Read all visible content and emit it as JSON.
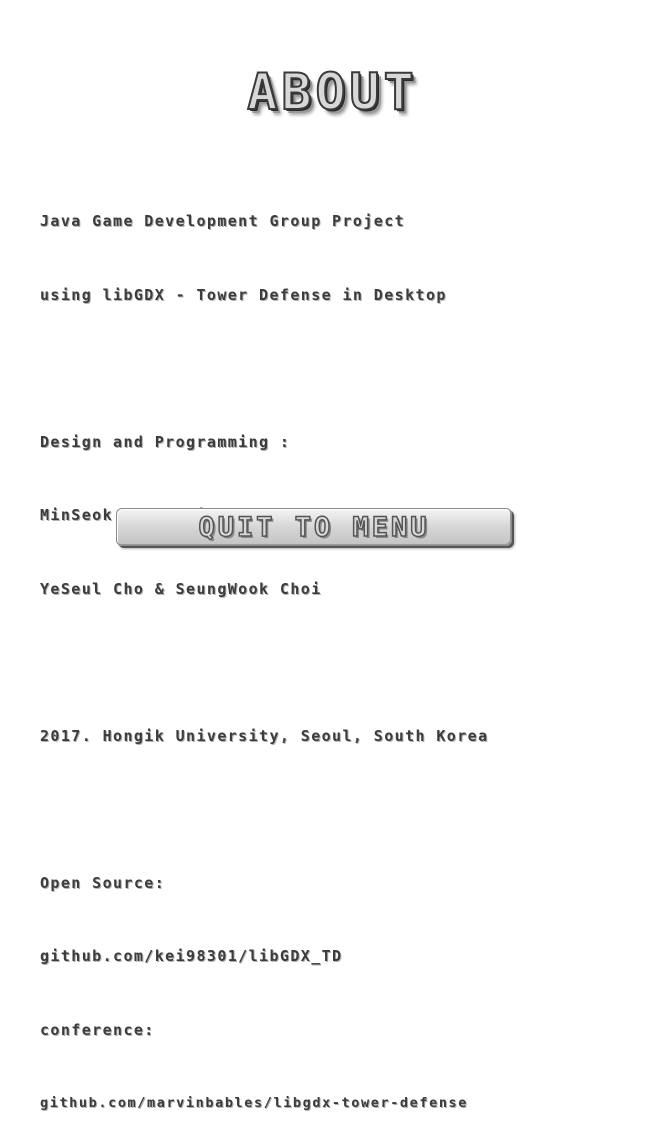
{
  "screen": {
    "title": "ABOUT"
  },
  "about": {
    "description_line1": "Java Game Development Group Project",
    "description_line2": "using libGDX - Tower Defense in Desktop",
    "credits_heading": "Design and Programming :",
    "credits_line1": "MinSeok Koo & MinWoo Jang & YoungIn Cho &",
    "credits_line2": "YeSeul Cho & SeungWook Choi",
    "affiliation": "2017. Hongik University, Seoul, South Korea",
    "open_source_label": "Open Source:",
    "open_source_link": "github.com/kei98301/libGDX_TD",
    "reference_label": "conference:",
    "reference_link": "github.com/marvinbables/libgdx-tower-defense"
  },
  "buttons": {
    "quit_label": "QUIT TO MENU"
  }
}
